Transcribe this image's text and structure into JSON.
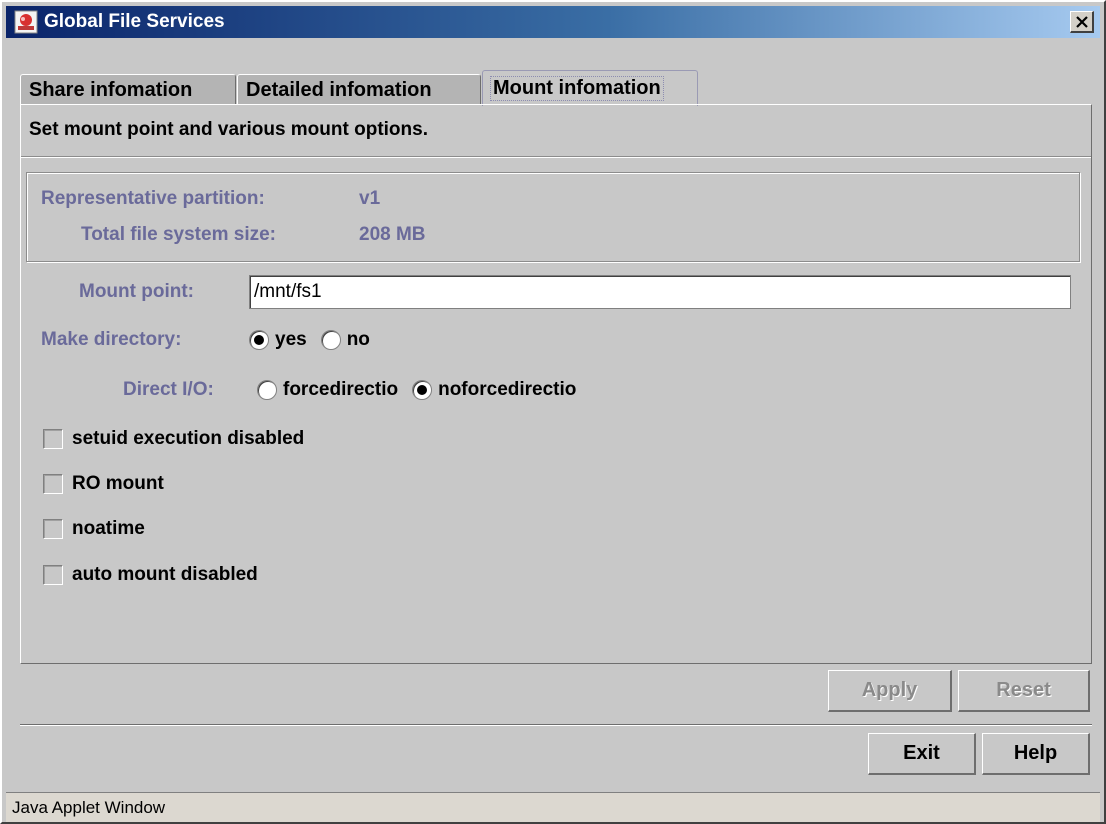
{
  "window": {
    "title": "Global File Services",
    "close_label": "✕"
  },
  "tabs": [
    {
      "label": "Share infomation",
      "active": false
    },
    {
      "label": "Detailed infomation",
      "active": false
    },
    {
      "label": "Mount infomation",
      "active": true
    }
  ],
  "panel": {
    "instruction": "Set mount point and various mount options.",
    "representative_partition_label": "Representative partition:",
    "representative_partition_value": "v1",
    "total_size_label": "Total file system size:",
    "total_size_value": "208 MB",
    "mount_point_label": "Mount point:",
    "mount_point_value": "/mnt/fs1",
    "make_directory_label": "Make directory:",
    "make_directory_options": [
      {
        "label": "yes",
        "checked": true
      },
      {
        "label": "no",
        "checked": false
      }
    ],
    "direct_io_label": "Direct I/O:",
    "direct_io_options": [
      {
        "label": "forcedirectio",
        "checked": false
      },
      {
        "label": "noforcedirectio",
        "checked": true
      }
    ],
    "checkboxes": [
      {
        "label": "setuid execution disabled",
        "checked": false
      },
      {
        "label": "RO mount",
        "checked": false
      },
      {
        "label": "noatime",
        "checked": false
      },
      {
        "label": "auto mount disabled",
        "checked": false
      }
    ]
  },
  "buttons": {
    "apply": "Apply",
    "reset": "Reset",
    "exit": "Exit",
    "help": "Help"
  },
  "status": {
    "text": "Java Applet Window"
  }
}
